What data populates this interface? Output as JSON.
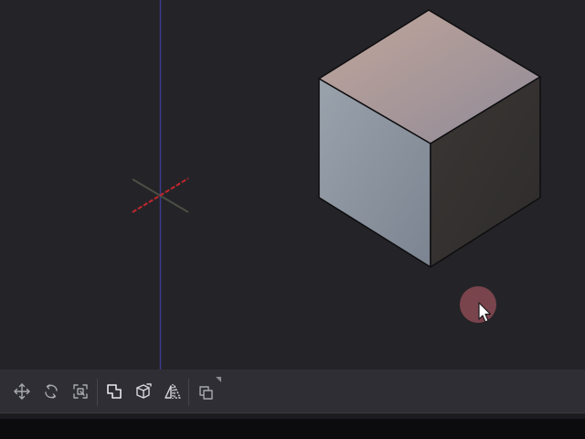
{
  "app": {
    "panel": "3D viewport"
  },
  "viewport": {
    "background_color": "#242428",
    "axes": {
      "y_axis_color": "#3a3a8c",
      "x_axis_color": "#c0262c",
      "z_axis_color": "#4a4e44"
    },
    "cube": {
      "top_face_color": "#b49a90",
      "left_face_color": "#8d95a0",
      "right_face_color": "#34312f",
      "edge_color": "#0e0e10"
    },
    "cursor_highlight_color": "#8a4a52"
  },
  "toolbar": {
    "tools": [
      {
        "name": "move-tool",
        "icon": "move-arrows-icon",
        "active": false
      },
      {
        "name": "rotate-tool",
        "icon": "rotate-icon",
        "active": false
      },
      {
        "name": "scale-tool",
        "icon": "scale-icon",
        "active": false
      },
      {
        "name": "union-tool",
        "icon": "boolean-union-icon",
        "active": true
      },
      {
        "name": "cube-tool",
        "icon": "cube-edit-icon",
        "active": false
      },
      {
        "name": "mirror-tool",
        "icon": "mirror-icon",
        "active": false
      },
      {
        "name": "duplicate-tool",
        "icon": "duplicate-icon",
        "active": false
      }
    ],
    "icon_color": "#a8a8b0",
    "active_icon_color": "#e8e8ee"
  }
}
